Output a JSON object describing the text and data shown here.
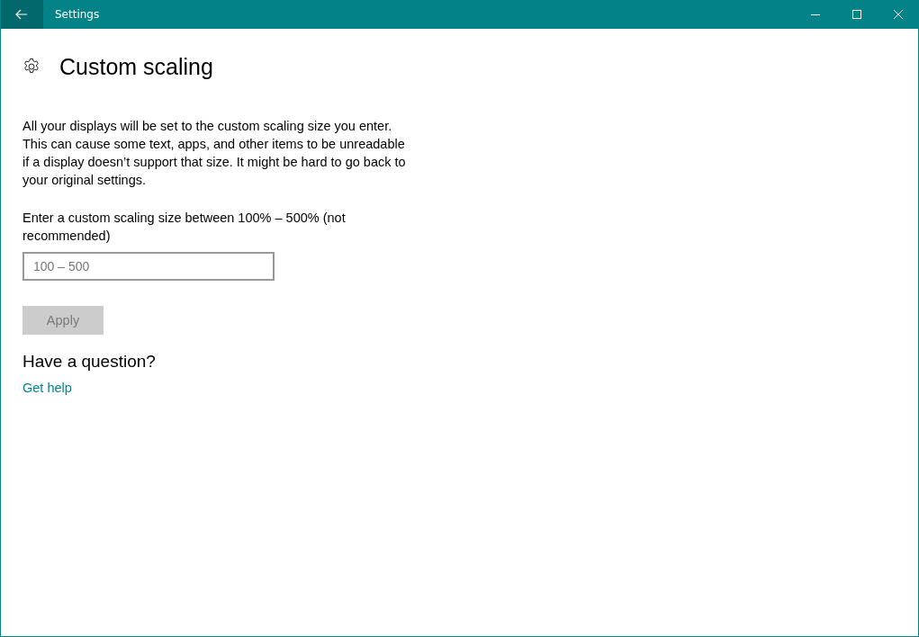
{
  "window": {
    "title": "Settings"
  },
  "page": {
    "title": "Custom scaling"
  },
  "description": "All your displays will be set to the custom scaling size you enter. This can cause some text, apps, and other items to be unreadable if a display doesn’t support that size. It might be hard to go back to your original settings.",
  "scaling_field": {
    "label": "Enter a custom scaling size between 100% – 500% (not recommended)",
    "placeholder": "100 – 500"
  },
  "apply_button": {
    "label": "Apply",
    "disabled": true
  },
  "help": {
    "heading": "Have a question?",
    "link": "Get help"
  }
}
